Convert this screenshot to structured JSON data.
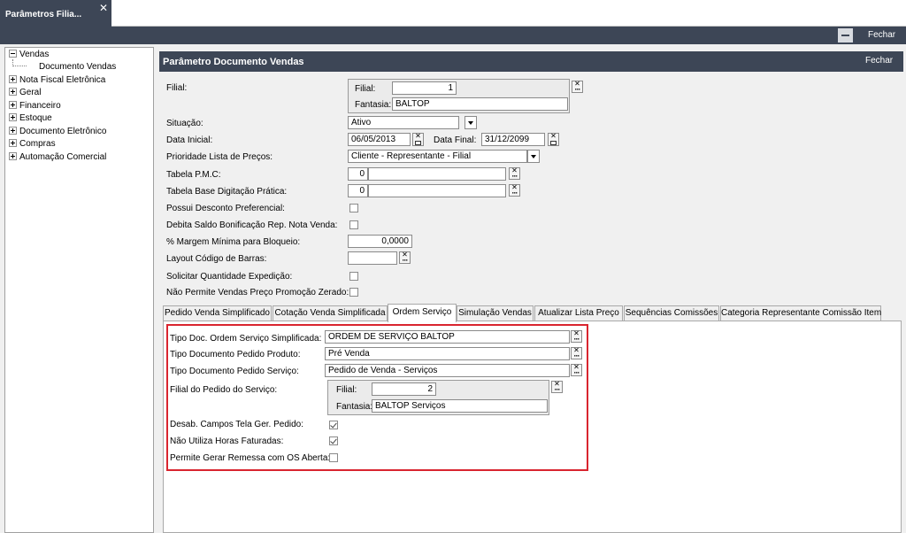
{
  "window_tab": {
    "title": "Parâmetros Filia...",
    "close_glyph": "✕"
  },
  "outer_header": {
    "close_label": "Fechar"
  },
  "tree": {
    "items": [
      {
        "label": "Vendas",
        "expanded": true
      },
      {
        "label": "Documento Vendas",
        "child": true
      },
      {
        "label": "Nota Fiscal Eletrônica"
      },
      {
        "label": "Geral"
      },
      {
        "label": "Financeiro"
      },
      {
        "label": "Estoque"
      },
      {
        "label": "Documento Eletrônico"
      },
      {
        "label": "Compras"
      },
      {
        "label": "Automação Comercial"
      }
    ]
  },
  "panel": {
    "title": "Parâmetro Documento Vendas",
    "close_label": "Fechar"
  },
  "form": {
    "filial_label": "Filial:",
    "filial_group": {
      "filial_label": "Filial:",
      "filial_value": "1",
      "fantasia_label": "Fantasia:",
      "fantasia_value": "BALTOP"
    },
    "situacao_label": "Situação:",
    "situacao_value": "Ativo",
    "data_inicial_label": "Data Inicial:",
    "data_inicial_value": "06/05/2013",
    "data_final_label": "Data Final:",
    "data_final_value": "31/12/2099",
    "prioridade_label": "Prioridade Lista de Preços:",
    "prioridade_value": "Cliente - Representante - Filial",
    "tabela_pmc_label": "Tabela P.M.C:",
    "tabela_pmc_value": "0",
    "tabela_base_label": "Tabela Base Digitação Prática:",
    "tabela_base_value": "0",
    "desconto_pref_label": "Possui Desconto Preferencial:",
    "debita_saldo_label": "Debita Saldo Bonificação Rep. Nota Venda:",
    "margem_label": "% Margem Mínima para Bloqueio:",
    "margem_value": "0,0000",
    "layout_label": "Layout Código de Barras:",
    "solicitar_label": "Solicitar Quantidade Expedição:",
    "nao_permite_label": "Não Permite Vendas Preço Promoção Zerado:"
  },
  "tabs": [
    {
      "label": "Pedido Venda Simplificado"
    },
    {
      "label": "Cotação Venda Simplificada"
    },
    {
      "label": "Ordem Serviço",
      "active": true
    },
    {
      "label": "Simulação Vendas"
    },
    {
      "label": "Atualizar Lista Preço"
    },
    {
      "label": "Sequências Comissões"
    },
    {
      "label": "Categoria Representante Comissão Item"
    }
  ],
  "ordem_servico": {
    "tipo_doc_label": "Tipo Doc. Ordem Serviço Simplificada:",
    "tipo_doc_value": "ORDEM DE SERVIÇO BALTOP",
    "tipo_produto_label": "Tipo Documento Pedido Produto:",
    "tipo_produto_value": "Pré Venda",
    "tipo_servico_label": "Tipo Documento Pedido Serviço:",
    "tipo_servico_value": "Pedido de Venda - Serviços",
    "filial_pedido_label": "Filial do Pedido do Serviço:",
    "filial_group": {
      "filial_label": "Filial:",
      "filial_value": "2",
      "fantasia_label": "Fantasia:",
      "fantasia_value": "BALTOP Serviços"
    },
    "desab_label": "Desab. Campos Tela Ger. Pedido:",
    "desab_checked": true,
    "horas_label": "Não Utiliza Horas Faturadas:",
    "horas_checked": true,
    "remessa_label": "Permite Gerar Remessa com OS Aberta:",
    "remessa_checked": false
  },
  "colors": {
    "header": "#3d4656",
    "highlight": "#d9252f"
  }
}
